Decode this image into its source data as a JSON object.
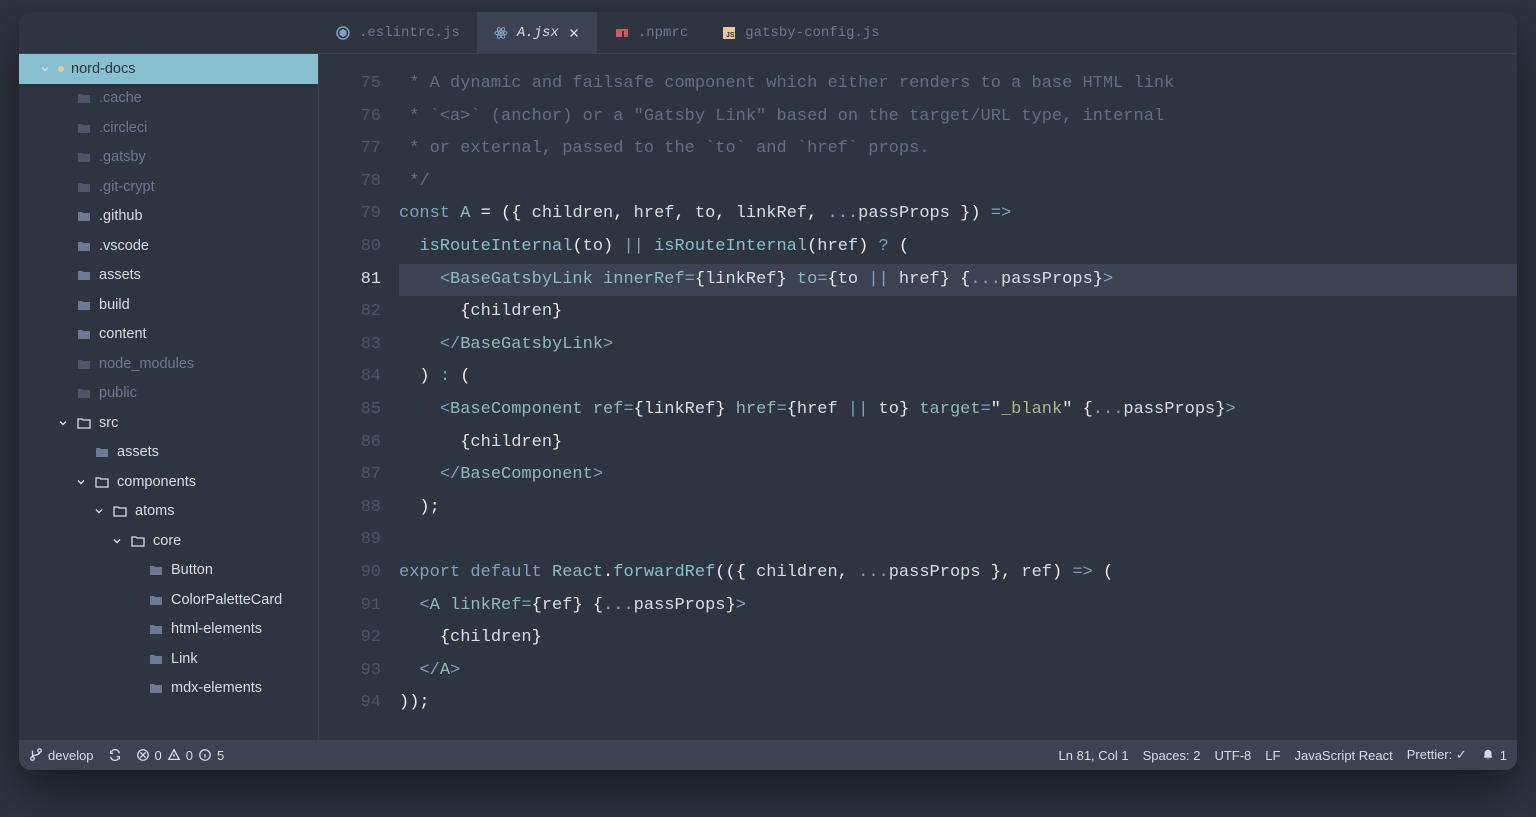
{
  "tabs": [
    {
      "file": ".eslintrc.js",
      "icon": "eslint",
      "active": false,
      "dirty": false
    },
    {
      "file": "A.jsx",
      "icon": "react",
      "active": true,
      "dirty": true
    },
    {
      "file": ".npmrc",
      "icon": "npm",
      "active": false,
      "dirty": false
    },
    {
      "file": "gatsby-config.js",
      "icon": "js",
      "active": false,
      "dirty": false
    }
  ],
  "explorer": {
    "root": "nord-docs",
    "items": [
      {
        "label": ".cache",
        "depth": 1,
        "kind": "folder",
        "bright": false
      },
      {
        "label": ".circleci",
        "depth": 1,
        "kind": "folder",
        "bright": false
      },
      {
        "label": ".gatsby",
        "depth": 1,
        "kind": "folder",
        "bright": false
      },
      {
        "label": ".git-crypt",
        "depth": 1,
        "kind": "folder",
        "bright": false
      },
      {
        "label": ".github",
        "depth": 1,
        "kind": "folder",
        "bright": true
      },
      {
        "label": ".vscode",
        "depth": 1,
        "kind": "folder",
        "bright": true
      },
      {
        "label": "assets",
        "depth": 1,
        "kind": "folder",
        "bright": true
      },
      {
        "label": "build",
        "depth": 1,
        "kind": "folder",
        "bright": true
      },
      {
        "label": "content",
        "depth": 1,
        "kind": "folder",
        "bright": true
      },
      {
        "label": "node_modules",
        "depth": 1,
        "kind": "folder",
        "bright": false
      },
      {
        "label": "public",
        "depth": 1,
        "kind": "folder",
        "bright": false
      },
      {
        "label": "src",
        "depth": 1,
        "kind": "folder-open",
        "bright": true,
        "arrow": "down"
      },
      {
        "label": "assets",
        "depth": 2,
        "kind": "folder",
        "bright": true
      },
      {
        "label": "components",
        "depth": 2,
        "kind": "folder-open",
        "bright": true,
        "arrow": "down"
      },
      {
        "label": "atoms",
        "depth": 3,
        "kind": "folder-open",
        "bright": true,
        "arrow": "down"
      },
      {
        "label": "core",
        "depth": 4,
        "kind": "folder-open",
        "bright": true,
        "arrow": "down"
      },
      {
        "label": "Button",
        "depth": 5,
        "kind": "folder",
        "bright": true
      },
      {
        "label": "ColorPaletteCard",
        "depth": 5,
        "kind": "folder",
        "bright": true
      },
      {
        "label": "html-elements",
        "depth": 5,
        "kind": "folder",
        "bright": true
      },
      {
        "label": "Link",
        "depth": 5,
        "kind": "folder",
        "bright": true
      },
      {
        "label": "mdx-elements",
        "depth": 5,
        "kind": "folder",
        "bright": true
      }
    ]
  },
  "editor": {
    "first_line_no": 75,
    "active_line_no": 81,
    "lines": [
      [
        {
          "t": " * A dynamic and failsafe component which either renders to a base HTML link",
          "c": "comment"
        }
      ],
      [
        {
          "t": " * `<a>` (anchor) or a \"Gatsby Link\" based on the target/URL type, internal",
          "c": "comment"
        }
      ],
      [
        {
          "t": " * or external, passed to the `to` and `href` props.",
          "c": "comment"
        }
      ],
      [
        {
          "t": " */",
          "c": "comment"
        }
      ],
      [
        {
          "t": "const ",
          "c": "kw"
        },
        {
          "t": "A",
          "c": "class"
        },
        {
          "t": " = ",
          "c": "punc"
        },
        {
          "t": "(",
          "c": "punc"
        },
        {
          "t": "{ ",
          "c": "punc"
        },
        {
          "t": "children",
          "c": "param"
        },
        {
          "t": ", ",
          "c": "punc"
        },
        {
          "t": "href",
          "c": "param"
        },
        {
          "t": ", ",
          "c": "punc"
        },
        {
          "t": "to",
          "c": "param"
        },
        {
          "t": ", ",
          "c": "punc"
        },
        {
          "t": "linkRef",
          "c": "param"
        },
        {
          "t": ", ",
          "c": "punc"
        },
        {
          "t": "...",
          "c": "kw"
        },
        {
          "t": "passProps",
          "c": "param"
        },
        {
          "t": " }",
          "c": "punc"
        },
        {
          "t": ")",
          "c": "punc"
        },
        {
          "t": " =>",
          "c": "kw"
        }
      ],
      [
        {
          "t": "  ",
          "c": "plain"
        },
        {
          "t": "isRouteInternal",
          "c": "fn"
        },
        {
          "t": "(",
          "c": "punc"
        },
        {
          "t": "to",
          "c": "param"
        },
        {
          "t": ") ",
          "c": "punc"
        },
        {
          "t": "||",
          "c": "kw"
        },
        {
          "t": " ",
          "c": "plain"
        },
        {
          "t": "isRouteInternal",
          "c": "fn"
        },
        {
          "t": "(",
          "c": "punc"
        },
        {
          "t": "href",
          "c": "param"
        },
        {
          "t": ") ",
          "c": "punc"
        },
        {
          "t": "?",
          "c": "kw"
        },
        {
          "t": " (",
          "c": "punc"
        }
      ],
      [
        {
          "t": "    ",
          "c": "plain"
        },
        {
          "t": "<",
          "c": "punc2"
        },
        {
          "t": "BaseGatsbyLink",
          "c": "class"
        },
        {
          "t": " ",
          "c": "plain"
        },
        {
          "t": "innerRef",
          "c": "attr"
        },
        {
          "t": "=",
          "c": "punc2"
        },
        {
          "t": "{",
          "c": "punc"
        },
        {
          "t": "linkRef",
          "c": "param"
        },
        {
          "t": "}",
          "c": "punc"
        },
        {
          "t": " ",
          "c": "plain"
        },
        {
          "t": "to",
          "c": "attr"
        },
        {
          "t": "=",
          "c": "punc2"
        },
        {
          "t": "{",
          "c": "punc"
        },
        {
          "t": "to ",
          "c": "param"
        },
        {
          "t": "||",
          "c": "kw"
        },
        {
          "t": " href",
          "c": "param"
        },
        {
          "t": "}",
          "c": "punc"
        },
        {
          "t": " ",
          "c": "plain"
        },
        {
          "t": "{",
          "c": "punc"
        },
        {
          "t": "...",
          "c": "kw"
        },
        {
          "t": "passProps",
          "c": "param"
        },
        {
          "t": "}",
          "c": "punc"
        },
        {
          "t": ">",
          "c": "punc2"
        }
      ],
      [
        {
          "t": "      ",
          "c": "plain"
        },
        {
          "t": "{",
          "c": "punc"
        },
        {
          "t": "children",
          "c": "param"
        },
        {
          "t": "}",
          "c": "punc"
        }
      ],
      [
        {
          "t": "    ",
          "c": "plain"
        },
        {
          "t": "</",
          "c": "punc2"
        },
        {
          "t": "BaseGatsbyLink",
          "c": "class"
        },
        {
          "t": ">",
          "c": "punc2"
        }
      ],
      [
        {
          "t": "  ) ",
          "c": "punc"
        },
        {
          "t": ":",
          "c": "kw"
        },
        {
          "t": " (",
          "c": "punc"
        }
      ],
      [
        {
          "t": "    ",
          "c": "plain"
        },
        {
          "t": "<",
          "c": "punc2"
        },
        {
          "t": "BaseComponent",
          "c": "class"
        },
        {
          "t": " ",
          "c": "plain"
        },
        {
          "t": "ref",
          "c": "attr"
        },
        {
          "t": "=",
          "c": "punc2"
        },
        {
          "t": "{",
          "c": "punc"
        },
        {
          "t": "linkRef",
          "c": "param"
        },
        {
          "t": "}",
          "c": "punc"
        },
        {
          "t": " ",
          "c": "plain"
        },
        {
          "t": "href",
          "c": "attr"
        },
        {
          "t": "=",
          "c": "punc2"
        },
        {
          "t": "{",
          "c": "punc"
        },
        {
          "t": "href ",
          "c": "param"
        },
        {
          "t": "||",
          "c": "kw"
        },
        {
          "t": " to",
          "c": "param"
        },
        {
          "t": "}",
          "c": "punc"
        },
        {
          "t": " ",
          "c": "plain"
        },
        {
          "t": "target",
          "c": "attr"
        },
        {
          "t": "=",
          "c": "punc2"
        },
        {
          "t": "\"",
          "c": "punc"
        },
        {
          "t": "_blank",
          "c": "str"
        },
        {
          "t": "\"",
          "c": "punc"
        },
        {
          "t": " ",
          "c": "plain"
        },
        {
          "t": "{",
          "c": "punc"
        },
        {
          "t": "...",
          "c": "kw"
        },
        {
          "t": "passProps",
          "c": "param"
        },
        {
          "t": "}",
          "c": "punc"
        },
        {
          "t": ">",
          "c": "punc2"
        }
      ],
      [
        {
          "t": "      ",
          "c": "plain"
        },
        {
          "t": "{",
          "c": "punc"
        },
        {
          "t": "children",
          "c": "param"
        },
        {
          "t": "}",
          "c": "punc"
        }
      ],
      [
        {
          "t": "    ",
          "c": "plain"
        },
        {
          "t": "</",
          "c": "punc2"
        },
        {
          "t": "BaseComponent",
          "c": "class"
        },
        {
          "t": ">",
          "c": "punc2"
        }
      ],
      [
        {
          "t": "  );",
          "c": "punc"
        }
      ],
      [
        {
          "t": "",
          "c": "plain"
        }
      ],
      [
        {
          "t": "export default ",
          "c": "kw"
        },
        {
          "t": "React",
          "c": "class"
        },
        {
          "t": ".",
          "c": "punc"
        },
        {
          "t": "forwardRef",
          "c": "fn"
        },
        {
          "t": "((",
          "c": "punc"
        },
        {
          "t": "{ ",
          "c": "punc"
        },
        {
          "t": "children",
          "c": "param"
        },
        {
          "t": ", ",
          "c": "punc"
        },
        {
          "t": "...",
          "c": "kw"
        },
        {
          "t": "passProps",
          "c": "param"
        },
        {
          "t": " }",
          "c": "punc"
        },
        {
          "t": ", ",
          "c": "punc"
        },
        {
          "t": "ref",
          "c": "param"
        },
        {
          "t": ") ",
          "c": "punc"
        },
        {
          "t": "=>",
          "c": "kw"
        },
        {
          "t": " (",
          "c": "punc"
        }
      ],
      [
        {
          "t": "  ",
          "c": "plain"
        },
        {
          "t": "<",
          "c": "punc2"
        },
        {
          "t": "A",
          "c": "class"
        },
        {
          "t": " ",
          "c": "plain"
        },
        {
          "t": "linkRef",
          "c": "attr"
        },
        {
          "t": "=",
          "c": "punc2"
        },
        {
          "t": "{",
          "c": "punc"
        },
        {
          "t": "ref",
          "c": "param"
        },
        {
          "t": "}",
          "c": "punc"
        },
        {
          "t": " ",
          "c": "plain"
        },
        {
          "t": "{",
          "c": "punc"
        },
        {
          "t": "...",
          "c": "kw"
        },
        {
          "t": "passProps",
          "c": "param"
        },
        {
          "t": "}",
          "c": "punc"
        },
        {
          "t": ">",
          "c": "punc2"
        }
      ],
      [
        {
          "t": "    ",
          "c": "plain"
        },
        {
          "t": "{",
          "c": "punc"
        },
        {
          "t": "children",
          "c": "param"
        },
        {
          "t": "}",
          "c": "punc"
        }
      ],
      [
        {
          "t": "  ",
          "c": "plain"
        },
        {
          "t": "</",
          "c": "punc2"
        },
        {
          "t": "A",
          "c": "class"
        },
        {
          "t": ">",
          "c": "punc2"
        }
      ],
      [
        {
          "t": "));",
          "c": "punc"
        }
      ]
    ]
  },
  "status": {
    "branch": "develop",
    "errors": "0",
    "warnings": "0",
    "info": "5",
    "cursor": "Ln 81, Col 1",
    "indent": "Spaces: 2",
    "encoding": "UTF-8",
    "eol": "LF",
    "lang": "JavaScript React",
    "prettier": "Prettier: ✓",
    "bell": "1"
  },
  "colors": {
    "bg": "#2E3440",
    "bg2": "#3B4252",
    "accent": "#88C0D0",
    "text": "#D8DEE9",
    "dim": "#6C7A96"
  }
}
